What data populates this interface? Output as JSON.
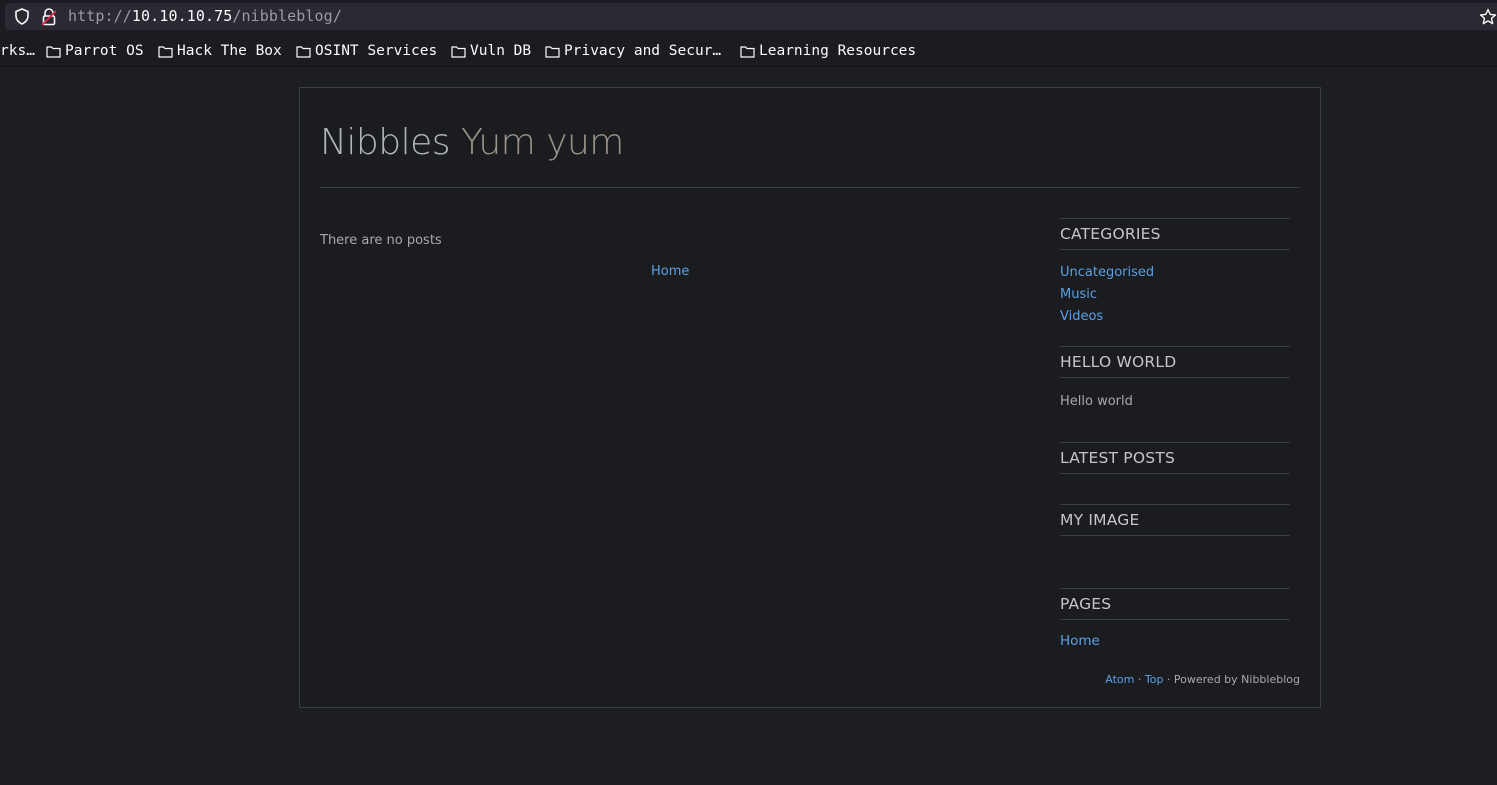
{
  "browser": {
    "url_scheme": "http://",
    "url_host": "10.10.10.75",
    "url_path": "/nibbleblog/",
    "bookmarks": [
      {
        "label": "rks…"
      },
      {
        "label": "Parrot OS"
      },
      {
        "label": "Hack The Box"
      },
      {
        "label": "OSINT Services"
      },
      {
        "label": "Vuln DB"
      },
      {
        "label": "Privacy and Secur…"
      },
      {
        "label": "Learning Resources"
      }
    ]
  },
  "site": {
    "name": "Nibbles",
    "slogan": "Yum yum"
  },
  "main": {
    "no_posts": "There are no posts",
    "home_link": "Home"
  },
  "sidebar": {
    "categories": {
      "title": "CATEGORIES",
      "items": [
        "Uncategorised",
        "Music",
        "Videos"
      ]
    },
    "hello": {
      "title": "HELLO WORLD",
      "text": "Hello world"
    },
    "latest": {
      "title": "LATEST POSTS"
    },
    "image": {
      "title": "MY IMAGE"
    },
    "pages": {
      "title": "PAGES",
      "items": [
        "Home"
      ]
    }
  },
  "footer": {
    "atom": "Atom",
    "sep1": " · ",
    "top": "Top",
    "powered": " · Powered by Nibbleblog"
  },
  "colors": {
    "background": "#1c1e21",
    "link": "#5aa0e6",
    "text": "#a9a9a9"
  }
}
